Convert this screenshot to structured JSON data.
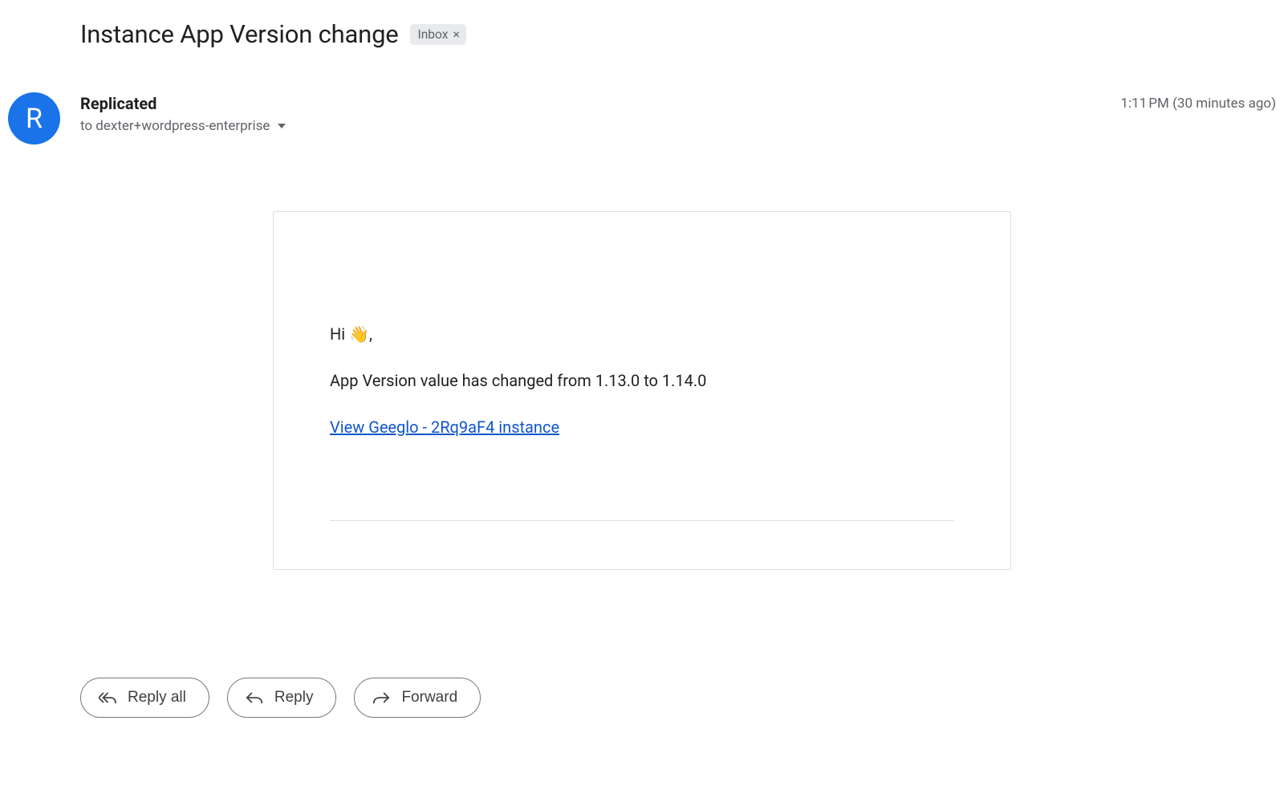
{
  "subject": "Instance App Version change",
  "chip": {
    "label": "Inbox"
  },
  "avatar_letter": "R",
  "sender": "Replicated",
  "recipient_line": "to dexter+wordpress-enterprise",
  "timestamp": "1:11 PM (30 minutes ago)",
  "body": {
    "greeting_prefix": "Hi ",
    "greeting_suffix": ",",
    "line": "App Version value has changed from 1.13.0 to 1.14.0",
    "link_text": "View Geeglo - 2Rq9aF4 instance"
  },
  "actions": {
    "reply_all": "Reply all",
    "reply": "Reply",
    "forward": "Forward"
  }
}
